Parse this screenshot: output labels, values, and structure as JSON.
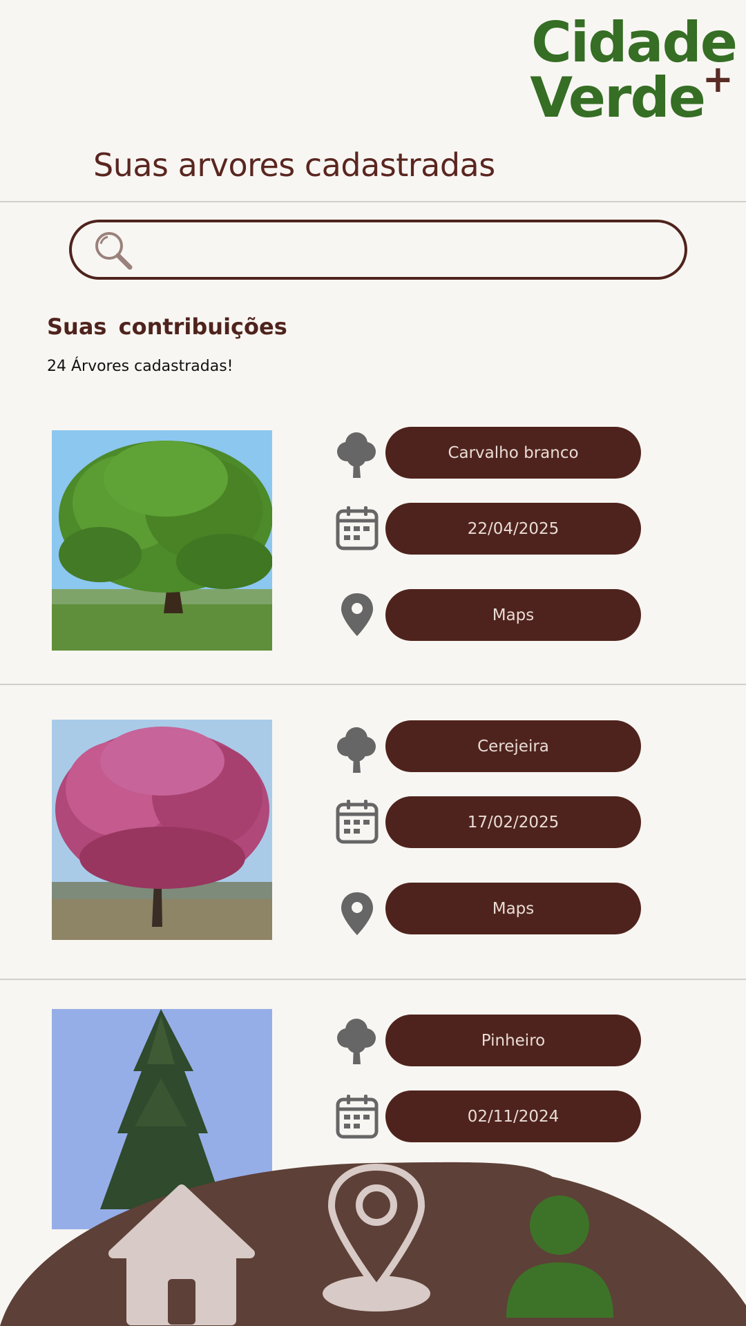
{
  "app": {
    "logo_line1": "Cidade",
    "logo_line2": "Verde",
    "logo_plus": "+"
  },
  "header": {
    "title": "Suas arvores cadastradas"
  },
  "search": {
    "placeholder": ""
  },
  "contributions": {
    "title": "Suas  contribuições",
    "count_text": "24 Árvores cadastradas!"
  },
  "trees": [
    {
      "name": "Carvalho branco",
      "date": "22/04/2025",
      "location_label": "Maps",
      "photo": "oak-tree-photo"
    },
    {
      "name": "Cerejeira",
      "date": "17/02/2025",
      "location_label": "Maps",
      "photo": "cherry-tree-photo"
    },
    {
      "name": "Pinheiro",
      "date": "02/11/2024",
      "photo": "pine-tree-photo"
    }
  ],
  "nav": {
    "items": [
      "home-icon",
      "map-pin-icon",
      "profile-icon"
    ],
    "active": "profile-icon"
  },
  "colors": {
    "background": "#f8f6f2",
    "brand_green": "#356e24",
    "brand_brown": "#4f231d",
    "pill_text": "#e9dcd6",
    "nav_bg": "#5d4037",
    "nav_icon": "#d8cac6",
    "icon_grey": "#666666"
  }
}
